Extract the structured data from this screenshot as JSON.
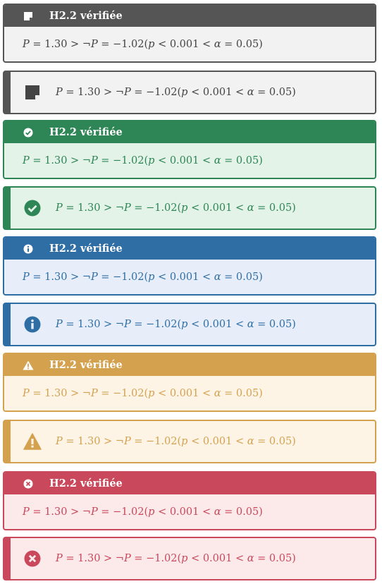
{
  "title": "H2.2 vérifiée",
  "formula": "P = 1.30 > ¬P = −1.02(p < 0.001 < α = 0.05)",
  "formula_parts": {
    "a": "P",
    "b": " = 1.30 > ¬",
    "c": "P",
    "d": " = −1.02(",
    "e": "p",
    "f": " < 0.001 < ",
    "g": "α",
    "h": " = 0.05)"
  },
  "themes": {
    "note": {
      "color": "#555555",
      "bg": "#f2f2f2",
      "icon": "note-icon"
    },
    "success": {
      "color": "#2e8555",
      "bg": "#e3f3e8",
      "icon": "check-circle-icon"
    },
    "info": {
      "color": "#2f6ea5",
      "bg": "#e7eefa",
      "icon": "info-circle-icon"
    },
    "warning": {
      "color": "#d4a24f",
      "bg": "#fdf4e6",
      "icon": "warning-triangle-icon"
    },
    "danger": {
      "color": "#c9485b",
      "bg": "#fce9ea",
      "icon": "x-circle-icon"
    }
  }
}
